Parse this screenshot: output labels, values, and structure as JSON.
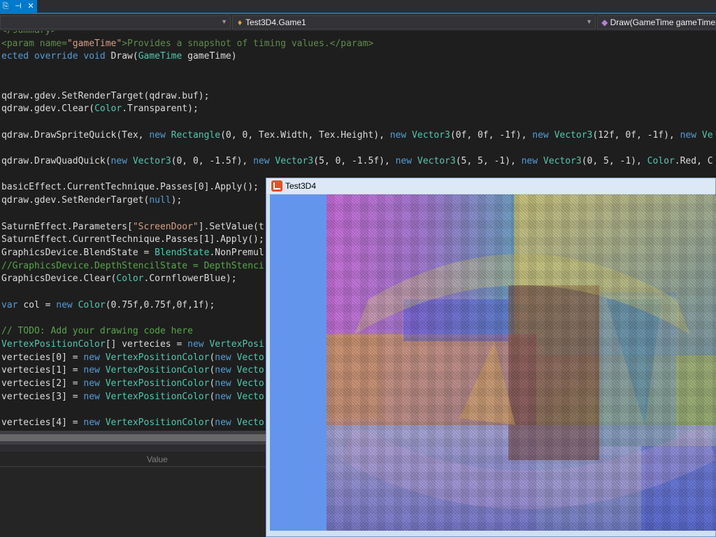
{
  "tabs": {
    "pin_icon": "pin-icon",
    "unpin_icon": "unpin-icon",
    "close_icon": "close-icon"
  },
  "nav": {
    "project_combo": "",
    "class_combo": "Test3D4.Game1",
    "member_combo": "Draw(GameTime gameTime)"
  },
  "code_lines": [
    [
      {
        "t": "</summary>",
        "c": "xm"
      }
    ],
    [
      {
        "t": "<param name=",
        "c": "xm"
      },
      {
        "t": "\"gameTime\"",
        "c": "xv"
      },
      {
        "t": ">Provides a snapshot of timing values.</param>",
        "c": "xm"
      }
    ],
    [
      {
        "t": "ected override void ",
        "c": "kw"
      },
      {
        "t": "Draw(",
        "c": ""
      },
      {
        "t": "GameTime",
        "c": "ty"
      },
      {
        "t": " gameTime)",
        "c": ""
      }
    ],
    [],
    [],
    [
      {
        "t": "qdraw.gdev.SetRenderTarget(qdraw.buf);",
        "c": ""
      }
    ],
    [
      {
        "t": "qdraw.gdev.Clear(",
        "c": ""
      },
      {
        "t": "Color",
        "c": "ty"
      },
      {
        "t": ".Transparent);",
        "c": ""
      }
    ],
    [],
    [
      {
        "t": "qdraw.DrawSpriteQuick(Tex, ",
        "c": ""
      },
      {
        "t": "new ",
        "c": "kw"
      },
      {
        "t": "Rectangle",
        "c": "ty"
      },
      {
        "t": "(0, 0, Tex.Width, Tex.Height), ",
        "c": ""
      },
      {
        "t": "new ",
        "c": "kw"
      },
      {
        "t": "Vector3",
        "c": "ty"
      },
      {
        "t": "(0f, 0f, -1f), ",
        "c": ""
      },
      {
        "t": "new ",
        "c": "kw"
      },
      {
        "t": "Vector3",
        "c": "ty"
      },
      {
        "t": "(12f, 0f, -1f), ",
        "c": ""
      },
      {
        "t": "new ",
        "c": "kw"
      },
      {
        "t": "Ve",
        "c": "ty"
      }
    ],
    [],
    [
      {
        "t": "qdraw.DrawQuadQuick(",
        "c": ""
      },
      {
        "t": "new ",
        "c": "kw"
      },
      {
        "t": "Vector3",
        "c": "ty"
      },
      {
        "t": "(0, 0, -1.5f), ",
        "c": ""
      },
      {
        "t": "new ",
        "c": "kw"
      },
      {
        "t": "Vector3",
        "c": "ty"
      },
      {
        "t": "(5, 0, -1.5f), ",
        "c": ""
      },
      {
        "t": "new ",
        "c": "kw"
      },
      {
        "t": "Vector3",
        "c": "ty"
      },
      {
        "t": "(5, 5, -1), ",
        "c": ""
      },
      {
        "t": "new ",
        "c": "kw"
      },
      {
        "t": "Vector3",
        "c": "ty"
      },
      {
        "t": "(0, 5, -1), ",
        "c": ""
      },
      {
        "t": "Color",
        "c": "ty"
      },
      {
        "t": ".Red, C",
        "c": ""
      }
    ],
    [],
    [
      {
        "t": "basicEffect.CurrentTechnique.Passes[0].Apply();",
        "c": ""
      }
    ],
    [
      {
        "t": "qdraw.gdev.SetRenderTarget(",
        "c": ""
      },
      {
        "t": "null",
        "c": "kw"
      },
      {
        "t": ");",
        "c": ""
      }
    ],
    [],
    [
      {
        "t": "SaturnEffect.Parameters[",
        "c": ""
      },
      {
        "t": "\"ScreenDoor\"",
        "c": "st"
      },
      {
        "t": "].SetValue(t",
        "c": ""
      }
    ],
    [
      {
        "t": "SaturnEffect.CurrentTechnique.Passes[1].Apply();",
        "c": ""
      }
    ],
    [
      {
        "t": "GraphicsDevice.BlendState = ",
        "c": ""
      },
      {
        "t": "BlendState",
        "c": "ty"
      },
      {
        "t": ".NonPremul",
        "c": ""
      }
    ],
    [
      {
        "t": "//GraphicsDevice.DepthStencilState = DepthStenci",
        "c": "cm"
      }
    ],
    [
      {
        "t": "GraphicsDevice.Clear(",
        "c": ""
      },
      {
        "t": "Color",
        "c": "ty"
      },
      {
        "t": ".CornflowerBlue);",
        "c": ""
      }
    ],
    [],
    [
      {
        "t": "var ",
        "c": "kw"
      },
      {
        "t": "col = ",
        "c": ""
      },
      {
        "t": "new ",
        "c": "kw"
      },
      {
        "t": "Color",
        "c": "ty"
      },
      {
        "t": "(0.75f,0.75f,0f,1f);",
        "c": ""
      }
    ],
    [],
    [
      {
        "t": "// TODO: Add your drawing code here",
        "c": "cm"
      }
    ],
    [
      {
        "t": "VertexPositionColor",
        "c": "ty"
      },
      {
        "t": "[] vertecies = ",
        "c": ""
      },
      {
        "t": "new ",
        "c": "kw"
      },
      {
        "t": "VertexPosi",
        "c": "ty"
      }
    ],
    [
      {
        "t": "vertecies[0] = ",
        "c": ""
      },
      {
        "t": "new ",
        "c": "kw"
      },
      {
        "t": "VertexPositionColor",
        "c": "ty"
      },
      {
        "t": "(",
        "c": ""
      },
      {
        "t": "new ",
        "c": "kw"
      },
      {
        "t": "Vecto",
        "c": "ty"
      }
    ],
    [
      {
        "t": "vertecies[1] = ",
        "c": ""
      },
      {
        "t": "new ",
        "c": "kw"
      },
      {
        "t": "VertexPositionColor",
        "c": "ty"
      },
      {
        "t": "(",
        "c": ""
      },
      {
        "t": "new ",
        "c": "kw"
      },
      {
        "t": "Vecto",
        "c": "ty"
      }
    ],
    [
      {
        "t": "vertecies[2] = ",
        "c": ""
      },
      {
        "t": "new ",
        "c": "kw"
      },
      {
        "t": "VertexPositionColor",
        "c": "ty"
      },
      {
        "t": "(",
        "c": ""
      },
      {
        "t": "new ",
        "c": "kw"
      },
      {
        "t": "Vecto",
        "c": "ty"
      }
    ],
    [
      {
        "t": "vertecies[3] = ",
        "c": ""
      },
      {
        "t": "new ",
        "c": "kw"
      },
      {
        "t": "VertexPositionColor",
        "c": "ty"
      },
      {
        "t": "(",
        "c": ""
      },
      {
        "t": "new ",
        "c": "kw"
      },
      {
        "t": "Vecto",
        "c": "ty"
      }
    ],
    [],
    [
      {
        "t": "vertecies[4] = ",
        "c": ""
      },
      {
        "t": "new ",
        "c": "kw"
      },
      {
        "t": "VertexPositionColor",
        "c": "ty"
      },
      {
        "t": "(",
        "c": ""
      },
      {
        "t": "new ",
        "c": "kw"
      },
      {
        "t": "Vecto",
        "c": "ty"
      }
    ]
  ],
  "bottom_panel": {
    "column_value": "Value"
  },
  "game_window": {
    "title": "Test3D4",
    "clear_color": "#6495ED"
  }
}
